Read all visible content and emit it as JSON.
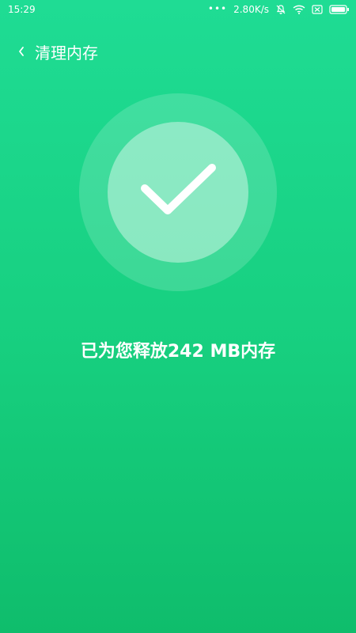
{
  "status_bar": {
    "time": "15:29",
    "dots": "•••",
    "network_speed": "2.80K/s",
    "icons": [
      "bell-off-icon",
      "wifi-icon",
      "close-box-icon",
      "battery-icon"
    ]
  },
  "header": {
    "title": "清理内存",
    "back_icon": "chevron-left-icon"
  },
  "result": {
    "message": "已为您释放242 MB内存",
    "icon": "checkmark-icon"
  },
  "colors": {
    "background_top": "#1fdc94",
    "background_bottom": "#0fbd6c",
    "text": "#ffffff"
  }
}
